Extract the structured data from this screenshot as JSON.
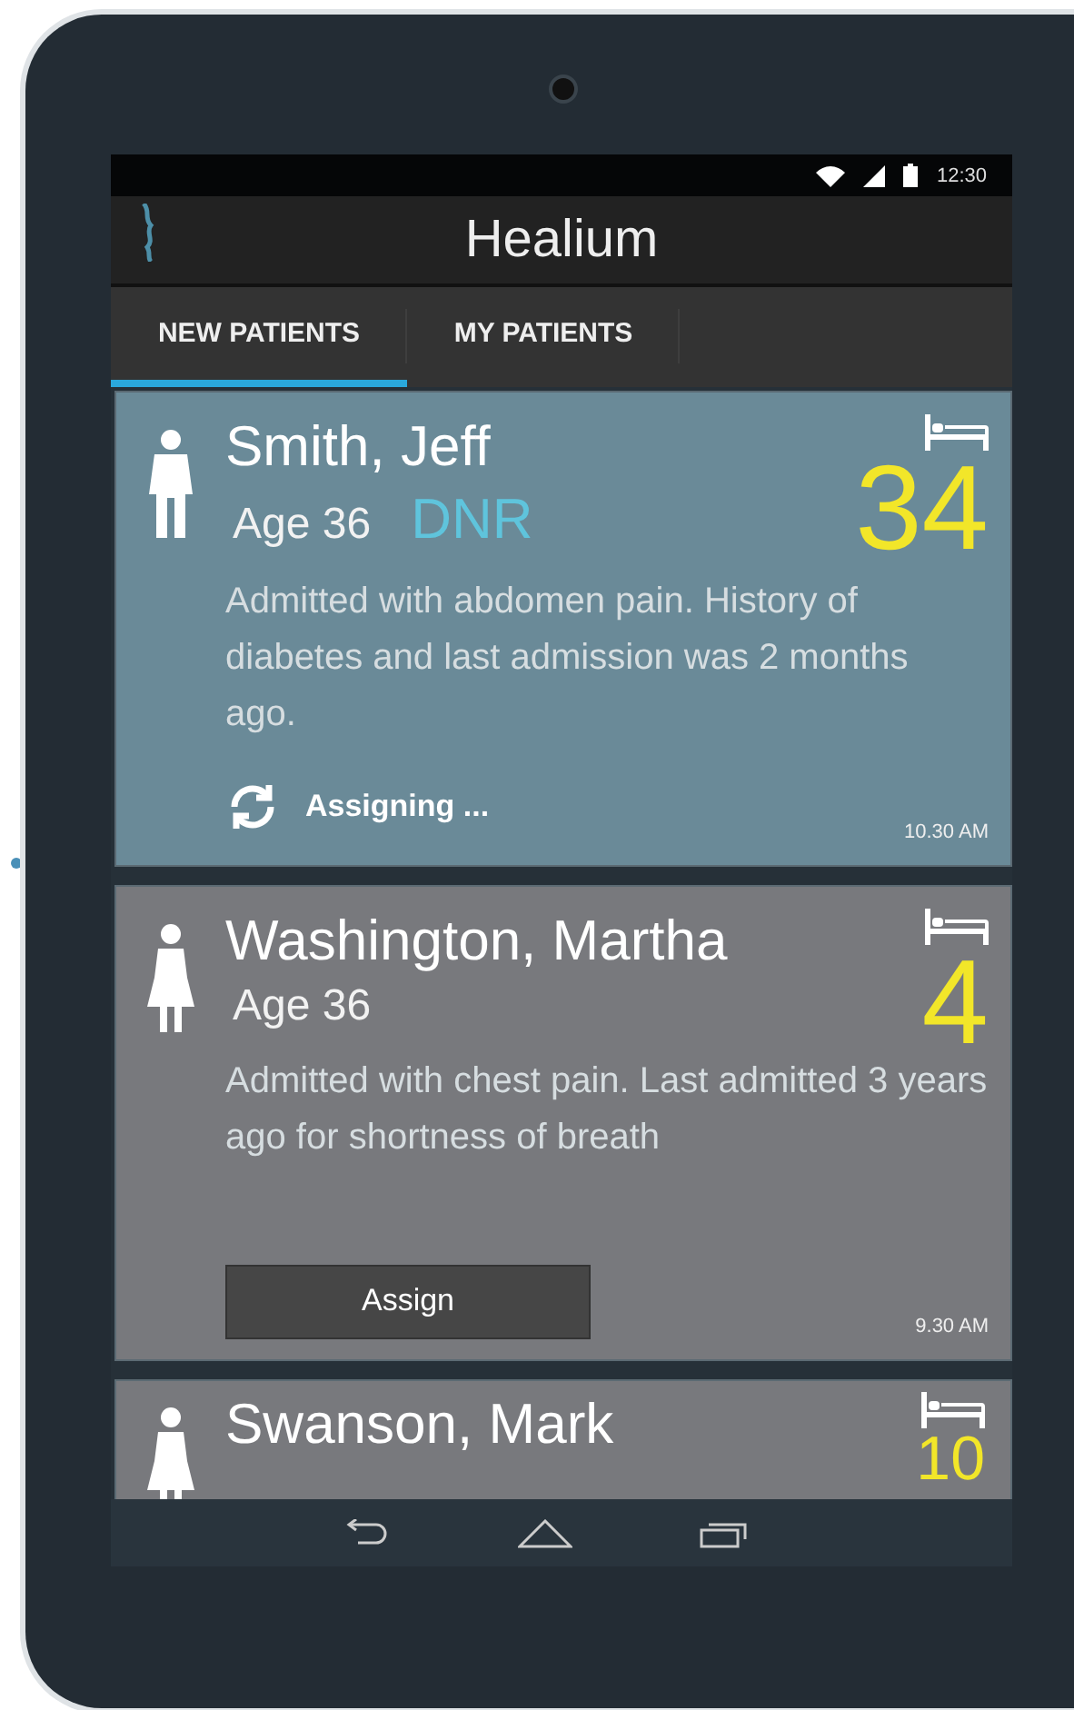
{
  "status_bar": {
    "time": "12:30"
  },
  "app_bar": {
    "title": "Healium"
  },
  "tabs": [
    {
      "label": "NEW PATIENTS",
      "selected": true
    },
    {
      "label": "MY PATIENTS",
      "selected": false
    }
  ],
  "patients": [
    {
      "name": "Smith, Jeff",
      "kind": "man",
      "age": "Age 36",
      "code": "DNR",
      "bed": "34",
      "note": "Admitted with abdomen pain.  History of diabetes and last admission was 2 months ago.",
      "selected": true,
      "action": {
        "kind": "progress",
        "label": "Assigning ..."
      },
      "time": "10.30 AM"
    },
    {
      "name": "Washington, Martha",
      "kind": "woman",
      "age": "Age 36",
      "bed": "4",
      "note": "Admitted with chest pain.  Last admitted 3 years ago for shortness of breath",
      "selected": false,
      "action": {
        "kind": "button",
        "label": "Assign"
      },
      "time": "9.30 AM"
    },
    {
      "name": "Swanson, Mark",
      "kind": "woman",
      "bed": "10",
      "selected": false
    }
  ]
}
